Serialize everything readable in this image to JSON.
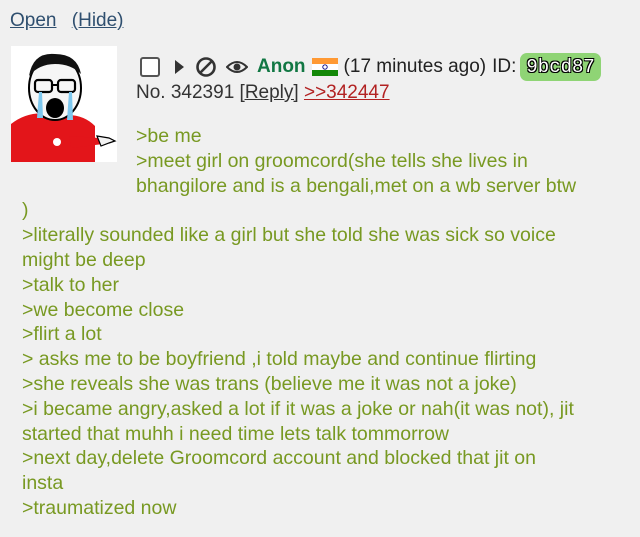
{
  "top_links": {
    "open": "Open",
    "hide": "(Hide)"
  },
  "post": {
    "name": "Anon",
    "time": "(17 minutes ago)",
    "id_label": "ID:",
    "id_value": "9bcd87",
    "no_label": "No.",
    "number": "342391",
    "reply_link": "[Reply]",
    "quote_link": ">>342447"
  },
  "icons": {
    "checkbox": "checkbox-icon",
    "expand": "triangle-right-icon",
    "hide": "no-entry-icon",
    "watch": "eye-icon",
    "flag": "india-flag-icon",
    "thumbnail": "crying-wojak-image"
  },
  "colors": {
    "greentext": "#789922",
    "name": "#117743",
    "quote": "#b22222",
    "id_badge": "#8fd475",
    "background": "#f0f0f0"
  },
  "body_lines": [
    ">be me",
    ">meet girl on groomcord(she tells she lives in",
    "bhangilore and is a bengali,met on a wb server btw",
    ")",
    ">literally sounded like a girl but she told she was sick so voice",
    "might be deep",
    ">talk to her",
    ">we become close",
    ">flirt a lot",
    "> asks me to be boyfriend ,i told maybe and continue flirting",
    ">she reveals she was trans (believe me it was not a joke)",
    ">i became angry,asked a lot if it was a joke or nah(it was not), jit",
    "started that muhh i need time lets talk tommorrow",
    ">next day,delete Groomcord account and blocked that jit on",
    "insta",
    ">traumatized now"
  ]
}
